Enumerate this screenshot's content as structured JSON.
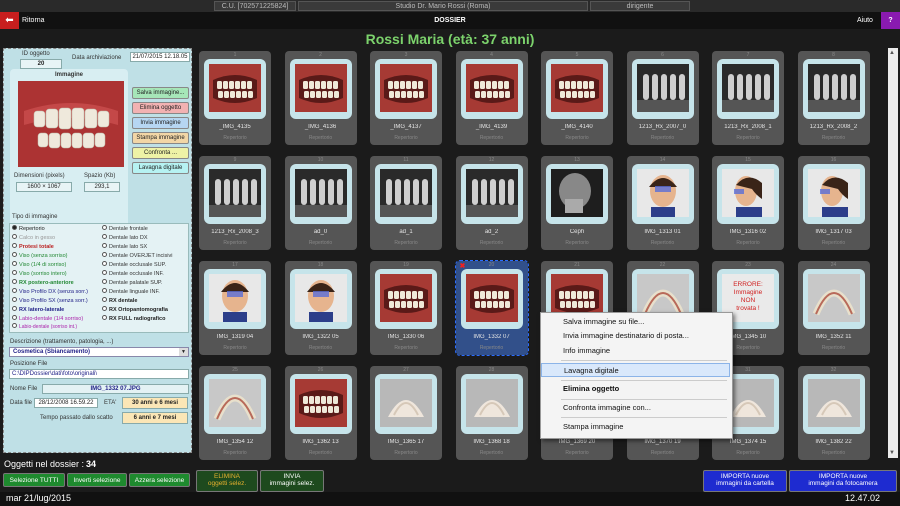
{
  "topbar": {
    "cf": "C.U. [702571225824]",
    "studio": "Studio Dr. Mario Rossi (Roma)",
    "role": "dirigente"
  },
  "title": {
    "back_label": "Ritorna",
    "page_title": "DOSSIER",
    "help_label": "Aiuto",
    "help_glyph": "?",
    "back_glyph": "⬅"
  },
  "patient": "Rossi Maria (età: 37 anni)",
  "left": {
    "id_label": "ID oggetto",
    "id_value": "20",
    "date_label": "Data archiviazione",
    "date_value": "21/07/2015 12.18.05",
    "image_label": "Immagine",
    "dims_label": "Dimensioni (pixels)",
    "dims_value": "1600 × 1067",
    "space_label": "Spazio (Kb)",
    "space_value": "293,1",
    "buttons": [
      "Salva immagine...",
      "Elimina oggetto",
      "Invia immagine",
      "Stampa immagine",
      "Confronta ...",
      "Lavagna digitale"
    ],
    "type_label": "Tipo di immagine",
    "types_left": [
      "Repertorio",
      "Calco in gesso",
      "Protesi totale",
      "Viso (senza sorriso)",
      "Viso (1/4 di sorriso)",
      "Viso (sorriso intero)",
      "RX postero-anteriore",
      "Viso Profilo DX (senza sorr.)",
      "Viso Profilo SX (senza sorr.)",
      "RX latero-laterale",
      "Labio-dentale (1/4 sorriso)",
      "Labio-dentale (sorriso int.)"
    ],
    "types_right": [
      "Dentale frontale",
      "Dentale lato DX",
      "Dentale lato SX",
      "Dentale OVERJET incisivi",
      "Dentale occlusale SUP.",
      "Dentale occlusale INF.",
      "Dentale palatale SUP.",
      "Dentale linguale INF.",
      "RX dentale",
      "RX Ortopantomografia",
      "RX FULL radiografico"
    ],
    "desc_label": "Descrizione (trattamento, patologia, ...)",
    "desc_value": "Cosmetica (Sbiancamento)",
    "path_label": "Posizione File",
    "path_value": "C:\\DIPDossier\\dati\\foto\\originali\\",
    "file_label": "Nome File",
    "file_value": "IMG_1332 07.JPG",
    "fdate_label": "Data file",
    "fdate_value": "28/12/2008 16.59.22",
    "eta_label": "ETA'",
    "eta_value": "30 anni e 6 mesi",
    "elapsed_label": "Tempo passato dallo scatto",
    "elapsed_value": "6 anni e 7 mesi"
  },
  "grid": [
    {
      "n": "1",
      "cap": "_IMG_4135",
      "cat": "Repertorio",
      "kind": "smile"
    },
    {
      "n": "2",
      "cap": "_IMG_4136",
      "cat": "Repertorio",
      "kind": "smile"
    },
    {
      "n": "3",
      "cap": "_IMG_4137",
      "cat": "Repertorio",
      "kind": "smile"
    },
    {
      "n": "4",
      "cap": "_IMG_4139",
      "cat": "Repertorio",
      "kind": "teeth"
    },
    {
      "n": "5",
      "cap": "_IMG_4140",
      "cat": "Repertorio",
      "kind": "smile"
    },
    {
      "n": "6",
      "cap": "1213_Rx_2007_0",
      "cat": "Repertorio",
      "kind": "xray"
    },
    {
      "n": "7",
      "cap": "1213_Rx_2008_1",
      "cat": "Repertorio",
      "kind": "xray"
    },
    {
      "n": "8",
      "cap": "1213_Rx_2008_2",
      "cat": "Repertorio",
      "kind": "xray"
    },
    {
      "n": "9",
      "cap": "1213_Rx_2008_3",
      "cat": "Repertorio",
      "kind": "xray"
    },
    {
      "n": "10",
      "cap": "ad_0",
      "cat": "Repertorio",
      "kind": "xray"
    },
    {
      "n": "11",
      "cap": "ad_1",
      "cat": "Repertorio",
      "kind": "xray"
    },
    {
      "n": "12",
      "cap": "ad_2",
      "cat": "Repertorio",
      "kind": "xray"
    },
    {
      "n": "13",
      "cap": "Ceph",
      "cat": "Repertorio",
      "kind": "ceph"
    },
    {
      "n": "14",
      "cap": "IMG_1313 01",
      "cat": "Repertorio",
      "kind": "face"
    },
    {
      "n": "15",
      "cap": "IMG_1316 02",
      "cat": "Repertorio",
      "kind": "profile"
    },
    {
      "n": "16",
      "cap": "IMG_1317 03",
      "cat": "Repertorio",
      "kind": "profile"
    },
    {
      "n": "17",
      "cap": "IMG_1319 04",
      "cat": "Repertorio",
      "kind": "face"
    },
    {
      "n": "18",
      "cap": "IMG_1322 05",
      "cat": "Repertorio",
      "kind": "face"
    },
    {
      "n": "19",
      "cap": "IMG_1330 06",
      "cat": "Repertorio",
      "kind": "teeth"
    },
    {
      "n": "20",
      "cap": "IMG_1332 07",
      "cat": "Repertorio",
      "kind": "teeth"
    },
    {
      "n": "21",
      "cap": "",
      "cat": "",
      "kind": "teeth"
    },
    {
      "n": "22",
      "cap": "",
      "cat": "",
      "kind": "arch"
    },
    {
      "n": "23",
      "cap": "IMG_1345 10",
      "cat": "Repertorio",
      "kind": "error"
    },
    {
      "n": "24",
      "cap": "IMG_1352 11",
      "cat": "Repertorio",
      "kind": "arch"
    },
    {
      "n": "25",
      "cap": "IMG_1354 12",
      "cat": "Repertorio",
      "kind": "arch"
    },
    {
      "n": "26",
      "cap": "IMG_1362 13",
      "cat": "Repertorio",
      "kind": "mouth"
    },
    {
      "n": "27",
      "cap": "IMG_1365 17",
      "cat": "Repertorio",
      "kind": "cast"
    },
    {
      "n": "28",
      "cap": "IMG_1368 18",
      "cat": "Repertorio",
      "kind": "cast"
    },
    {
      "n": "29",
      "cap": "IMG_1369 20",
      "cat": "Repertorio",
      "kind": "cast"
    },
    {
      "n": "30",
      "cap": "IMG_1370 19",
      "cat": "Repertorio",
      "kind": "cast"
    },
    {
      "n": "31",
      "cap": "IMG_1374 15",
      "cat": "Repertorio",
      "kind": "cast"
    },
    {
      "n": "32",
      "cap": "IMG_1382 22",
      "cat": "Repertorio",
      "kind": "cast"
    }
  ],
  "error_text": [
    "ERRORE:",
    "Immagine",
    "NON",
    "trovata !"
  ],
  "context_menu": [
    "Salva immagine su file...",
    "Invia immagine destinatario di posta...",
    "Info immagine",
    "Lavagna digitale",
    "Elimina oggetto",
    "Confronta immagine con...",
    "Stampa immagine"
  ],
  "bottom": {
    "count_label": "Oggetti nel dossier :",
    "count_value": "34",
    "sel_all": "Selezione TUTTI",
    "invert": "Inverti selezione",
    "clear": "Azzera selezione",
    "delete_l1": "ELIMINA",
    "delete_l2": "oggetti selez.",
    "send_l1": "INVIA",
    "send_l2": "immagini selez.",
    "import_dir_l1": "IMPORTA nuove",
    "import_dir_l2": "immagini da cartella",
    "import_cam_l1": "IMPORTA nuove",
    "import_cam_l2": "immagini da fotocamera"
  },
  "status": {
    "date": "mar 21/lug/2015",
    "time": "12.47.02"
  },
  "colors": {
    "accent_green": "#7cd36c",
    "back_red": "#c81e1e",
    "help_purple": "#8a1ab0",
    "import_blue": "#1e2bd0"
  }
}
